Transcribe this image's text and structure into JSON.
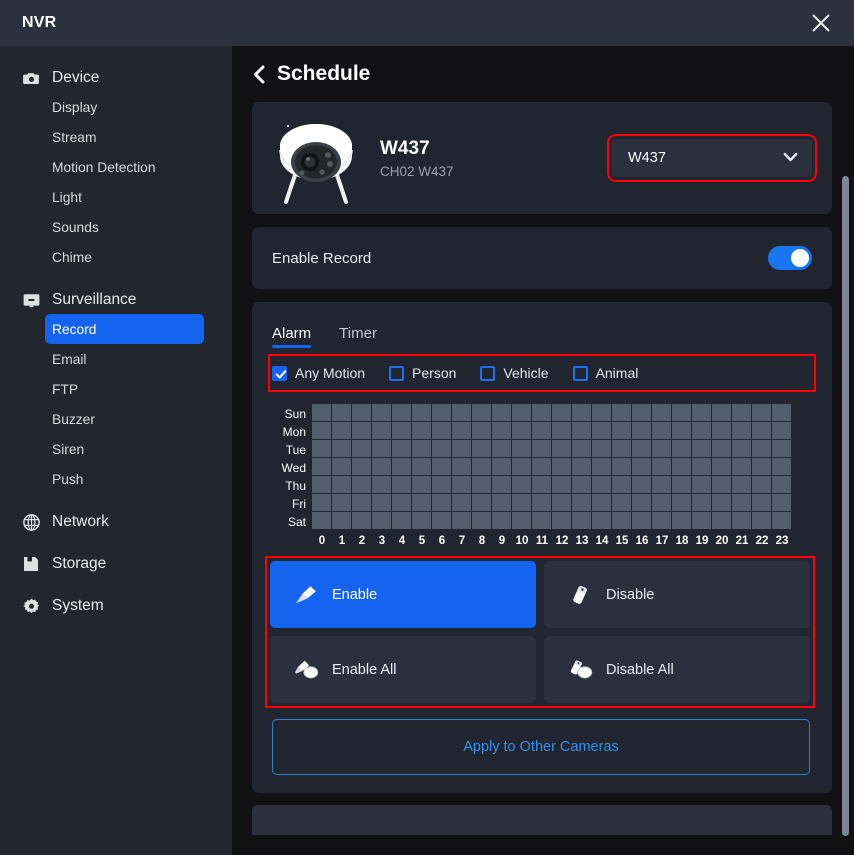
{
  "window": {
    "title": "NVR",
    "close_icon": "close-icon"
  },
  "sidebar": {
    "groups": [
      {
        "label": "Device",
        "icon": "camera-icon",
        "items": [
          "Display",
          "Stream",
          "Motion Detection",
          "Light",
          "Sounds",
          "Chime"
        ]
      },
      {
        "label": "Surveillance",
        "icon": "monitor-icon",
        "items": [
          "Record",
          "Email",
          "FTP",
          "Buzzer",
          "Siren",
          "Push"
        ],
        "active_item": "Record"
      },
      {
        "label": "Network",
        "icon": "globe-icon",
        "items": []
      },
      {
        "label": "Storage",
        "icon": "floppy-disk-icon",
        "items": []
      },
      {
        "label": "System",
        "icon": "gear-icon",
        "items": []
      }
    ]
  },
  "page": {
    "title": "Schedule",
    "back_icon": "chevron-left-icon"
  },
  "device": {
    "name": "W437",
    "channel": "CH02 W437",
    "selector_value": "W437",
    "selector_icon": "chevron-down-icon",
    "thumbnail": "dome-camera-image"
  },
  "record": {
    "label": "Enable Record",
    "enabled": true
  },
  "schedule": {
    "tabs": [
      {
        "label": "Alarm",
        "active": true
      },
      {
        "label": "Timer",
        "active": false
      }
    ],
    "detection_types": [
      {
        "label": "Any Motion",
        "checked": true
      },
      {
        "label": "Person",
        "checked": false
      },
      {
        "label": "Vehicle",
        "checked": false
      },
      {
        "label": "Animal",
        "checked": false
      }
    ],
    "days": [
      "Sun",
      "Mon",
      "Tue",
      "Wed",
      "Thu",
      "Fri",
      "Sat"
    ],
    "hours": [
      "0",
      "1",
      "2",
      "3",
      "4",
      "5",
      "6",
      "7",
      "8",
      "9",
      "10",
      "11",
      "12",
      "13",
      "14",
      "15",
      "16",
      "17",
      "18",
      "19",
      "20",
      "21",
      "22",
      "23"
    ],
    "cells_enabled": false,
    "actions": [
      {
        "label": "Enable",
        "icon": "brush-icon",
        "primary": true
      },
      {
        "label": "Disable",
        "icon": "eraser-icon",
        "primary": false
      },
      {
        "label": "Enable All",
        "icon": "brush-all-icon",
        "primary": false
      },
      {
        "label": "Disable All",
        "icon": "eraser-all-icon",
        "primary": false
      }
    ],
    "apply_label": "Apply to Other Cameras"
  },
  "colors": {
    "accent": "#1464f0",
    "highlight_outline": "#ff0000",
    "link": "#2f93ef",
    "cell": "#525e6b",
    "titlebar": "#2b323d",
    "sidebar": "#21262f",
    "main_bg": "#111114",
    "card": "#212530"
  }
}
